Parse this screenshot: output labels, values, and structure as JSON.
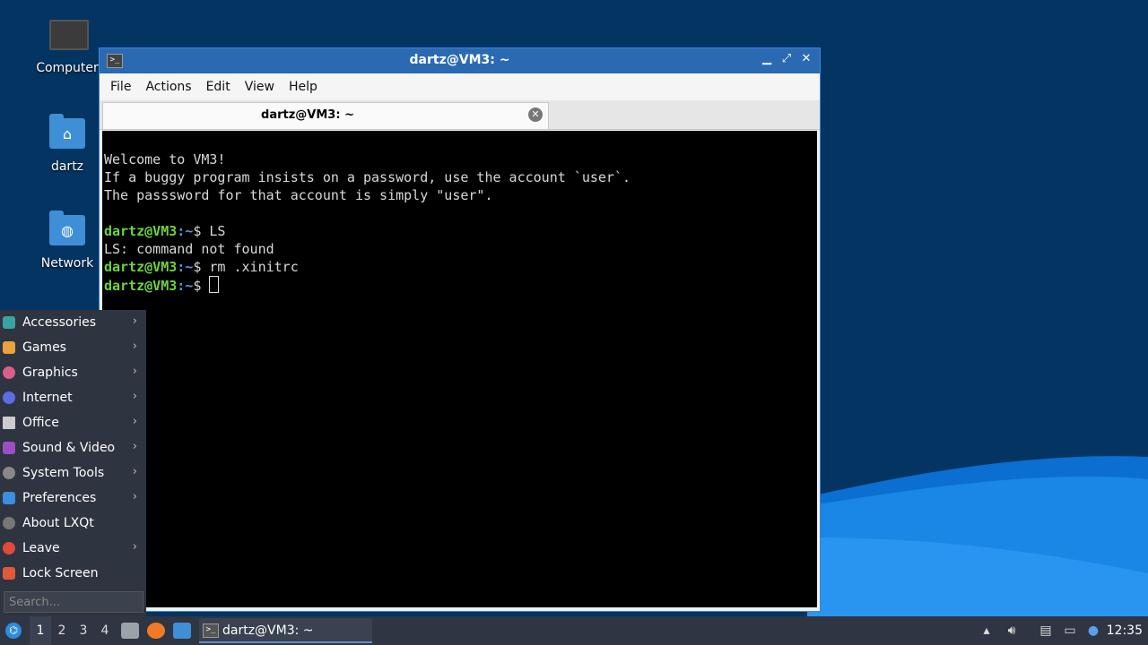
{
  "desktop": {
    "icons": [
      {
        "label": "Computer",
        "icon": "computer-icon"
      },
      {
        "label": "dartz",
        "icon": "home-folder-icon"
      },
      {
        "label": "Network",
        "icon": "network-folder-icon"
      }
    ]
  },
  "window": {
    "title": "dartz@VM3: ~",
    "menu": [
      "File",
      "Actions",
      "Edit",
      "View",
      "Help"
    ],
    "tab_title": "dartz@VM3: ~",
    "terminal": {
      "welcome": [
        "Welcome to VM3!",
        "If a buggy program insists on a password, use the account `user`.",
        "The passsword for that account is simply \"user\"."
      ],
      "prompt_user": "dartz@VM3",
      "prompt_path": ":~",
      "prompt_sign": "$ ",
      "cmd1": "LS",
      "out1": "LS: command not found",
      "cmd2": "rm .xinitrc"
    }
  },
  "app_menu": {
    "items": [
      {
        "label": "Accessories",
        "submenu": true,
        "color": "#3aa3a0"
      },
      {
        "label": "Games",
        "submenu": true,
        "color": "#e8a33a"
      },
      {
        "label": "Graphics",
        "submenu": true,
        "color": "#d95f8a"
      },
      {
        "label": "Internet",
        "submenu": true,
        "color": "#5b6ee0"
      },
      {
        "label": "Office",
        "submenu": true,
        "color": "#cccccc"
      },
      {
        "label": "Sound & Video",
        "submenu": true,
        "color": "#9b4fc0"
      },
      {
        "label": "System Tools",
        "submenu": true,
        "color": "#888888"
      },
      {
        "label": "Preferences",
        "submenu": true,
        "color": "#3a8fe0"
      },
      {
        "label": "About LXQt",
        "submenu": false,
        "color": "#777777"
      },
      {
        "label": "Leave",
        "submenu": true,
        "color": "#e04a3a"
      },
      {
        "label": "Lock Screen",
        "submenu": false,
        "color": "#e05a3a"
      }
    ],
    "search_placeholder": "Search..."
  },
  "taskbar": {
    "desktops": [
      "1",
      "2",
      "3",
      "4"
    ],
    "active_desktop": "1",
    "task_label": "dartz@VM3: ~",
    "clock": "12:35"
  },
  "colors": {
    "desktop_bg": "#033462",
    "title_bar": "#2b6ab3",
    "prompt_user": "#6ed33d",
    "prompt_path": "#4f9be0"
  }
}
